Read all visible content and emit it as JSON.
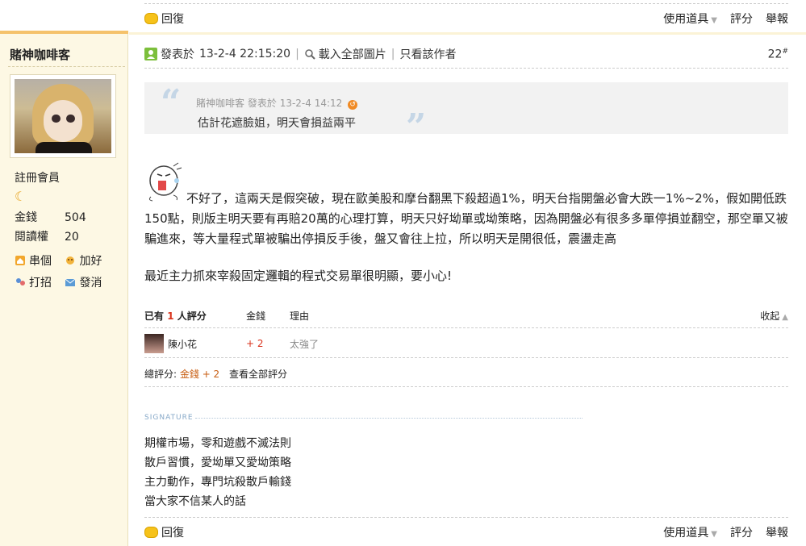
{
  "sidebar": {
    "author": "賭神咖啡客",
    "group": "註冊會員",
    "group_icon": "moon-icon",
    "stats": [
      {
        "label": "金錢",
        "value": "504"
      },
      {
        "label": "閱讀權",
        "value": "20"
      }
    ],
    "links": [
      {
        "label": "串個",
        "icon": "home-icon"
      },
      {
        "label": "加好",
        "icon": "add-friend-icon"
      },
      {
        "label": "打招",
        "icon": "greet-icon"
      },
      {
        "label": "發消",
        "icon": "message-icon"
      }
    ]
  },
  "top_bar": {
    "reply": "回復",
    "use_item": "使用道具",
    "rate": "評分",
    "report": "舉報"
  },
  "post": {
    "posted_label": "發表於",
    "posted_time": "13-2-4 22:15:20",
    "load_images": "載入全部圖片",
    "author_only": "只看該作者",
    "floor": "22",
    "floor_mark": "#"
  },
  "quote": {
    "author": "賭神咖啡客",
    "posted_label": "發表於",
    "time": "13-2-4 14:12",
    "text": "估計花遮臉姐，明天會損益兩平"
  },
  "content": {
    "paragraph1": "不好了，這兩天是假突破，現在歐美股和摩台翻黑下殺超過1%，明天台指開盤必會大跌一1%~2%，假如開低跌150點，則版主明天要有再賠20萬的心理打算，明天只好坳單或坳策略，因為開盤必有很多多單停損並翻空，那空單又被騙進來，等大量程式單被騙出停損反手後，盤又會往上拉，所以明天是開很低，震盪走高",
    "paragraph2": "最近主力抓來宰殺固定邏輯的程式交易單很明顯，要小心!"
  },
  "rating": {
    "prefix": "已有",
    "count": "1",
    "suffix": "人評分",
    "col_money": "金錢",
    "col_reason": "理由",
    "collapse": "收起",
    "rows": [
      {
        "user": "陳小花",
        "money": "+ 2",
        "reason": "太強了"
      }
    ],
    "total_label": "總評分:",
    "total_value": "金錢 + 2",
    "view_all": "查看全部評分"
  },
  "signature": {
    "title": "SIGNATURE",
    "lines": [
      "期權市場，零和遊戲不滅法則",
      "散戶習慣，愛坳單又愛坳策略",
      "主力動作，專門坑殺散戶輸錢",
      "當大家不信某人的話"
    ]
  },
  "bottom_bar": {
    "reply": "回復",
    "use_item": "使用道具",
    "rate": "評分",
    "report": "舉報"
  },
  "colors": {
    "sidebar_bg": "#fdf8e4",
    "accent_orange": "#f5c26b",
    "red": "#d9331d",
    "quote_bg": "#f2f2f2"
  }
}
